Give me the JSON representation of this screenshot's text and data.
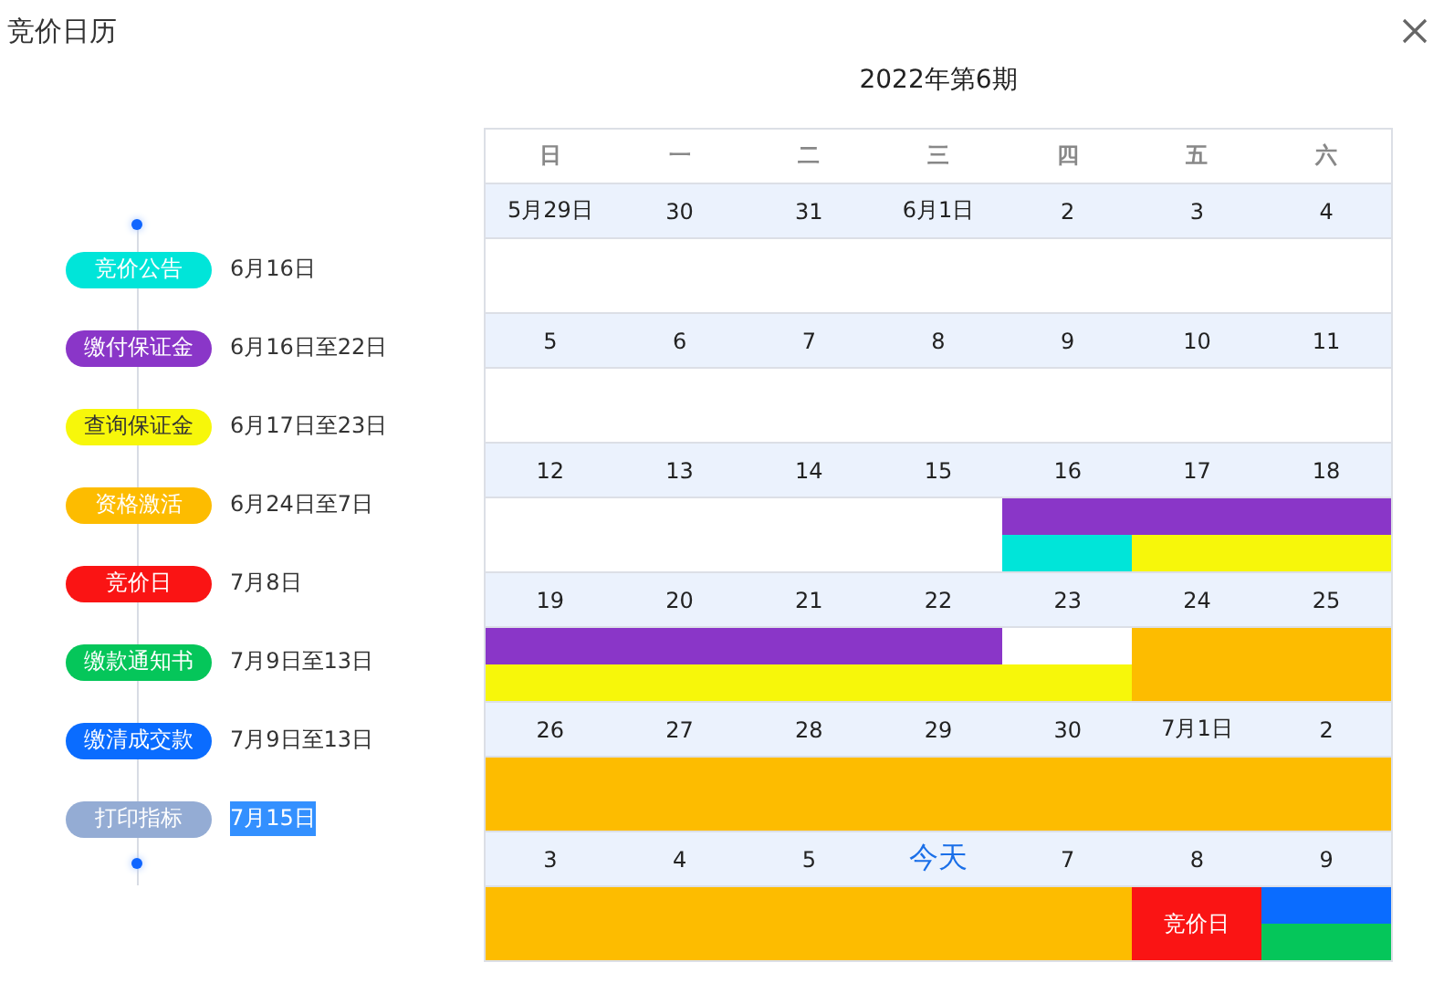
{
  "window": {
    "title": "竞价日历"
  },
  "legend": [
    {
      "label": "竞价公告",
      "dates": "6月16日",
      "color": "#00e5d9",
      "highlighted": false
    },
    {
      "label": "缴付保证金",
      "dates": "6月16日至22日",
      "color": "#8a36c8",
      "highlighted": false
    },
    {
      "label": "查询保证金",
      "dates": "6月17日至23日",
      "color": "#f7f70a",
      "highlighted": false
    },
    {
      "label": "资格激活",
      "dates": "6月24日至7日",
      "color": "#fdbc00",
      "highlighted": false
    },
    {
      "label": "竞价日",
      "dates": "7月8日",
      "color": "#fa1414",
      "highlighted": false
    },
    {
      "label": "缴款通知书",
      "dates": "7月9日至13日",
      "color": "#05c65a",
      "highlighted": false
    },
    {
      "label": "缴清成交款",
      "dates": "7月9日至13日",
      "color": "#0a6cff",
      "highlighted": false
    },
    {
      "label": "打印指标",
      "dates": "7月15日",
      "color": "#94acd4",
      "highlighted": true
    }
  ],
  "calendar": {
    "title": "2022年第6期",
    "weekdays": [
      "日",
      "一",
      "二",
      "三",
      "四",
      "五",
      "六"
    ],
    "weeks": [
      {
        "days": [
          {
            "label": "5月29日",
            "kind": "date"
          },
          {
            "label": "30",
            "kind": "date"
          },
          {
            "label": "31",
            "kind": "date"
          },
          {
            "label": "6月1日",
            "kind": "date"
          },
          {
            "label": "2",
            "kind": "date"
          },
          {
            "label": "3",
            "kind": "date"
          },
          {
            "label": "4",
            "kind": "date"
          }
        ]
      },
      {
        "days": [
          {
            "label": "5",
            "kind": "date"
          },
          {
            "label": "6",
            "kind": "date"
          },
          {
            "label": "7",
            "kind": "date"
          },
          {
            "label": "8",
            "kind": "date"
          },
          {
            "label": "9",
            "kind": "date"
          },
          {
            "label": "10",
            "kind": "date"
          },
          {
            "label": "11",
            "kind": "date"
          }
        ]
      },
      {
        "days": [
          {
            "label": "12",
            "kind": "date"
          },
          {
            "label": "13",
            "kind": "date"
          },
          {
            "label": "14",
            "kind": "date"
          },
          {
            "label": "15",
            "kind": "date"
          },
          {
            "label": "16",
            "kind": "date",
            "top": {
              "color": "#8a36c8"
            },
            "bottom": {
              "color": "#00e5d9"
            }
          },
          {
            "label": "17",
            "kind": "date",
            "top": {
              "color": "#8a36c8"
            },
            "bottom": {
              "color": "#f7f70a"
            }
          },
          {
            "label": "18",
            "kind": "date",
            "top": {
              "color": "#8a36c8"
            },
            "bottom": {
              "color": "#f7f70a"
            }
          }
        ]
      },
      {
        "days": [
          {
            "label": "19",
            "kind": "date",
            "top": {
              "color": "#8a36c8"
            },
            "bottom": {
              "color": "#f7f70a"
            }
          },
          {
            "label": "20",
            "kind": "date",
            "top": {
              "color": "#8a36c8"
            },
            "bottom": {
              "color": "#f7f70a"
            }
          },
          {
            "label": "21",
            "kind": "date",
            "top": {
              "color": "#8a36c8"
            },
            "bottom": {
              "color": "#f7f70a"
            }
          },
          {
            "label": "22",
            "kind": "date",
            "top": {
              "color": "#8a36c8"
            },
            "bottom": {
              "color": "#f7f70a"
            }
          },
          {
            "label": "23",
            "kind": "date",
            "bottom": {
              "color": "#f7f70a"
            }
          },
          {
            "label": "24",
            "kind": "date",
            "full": {
              "color": "#fdbc00"
            }
          },
          {
            "label": "25",
            "kind": "date",
            "full": {
              "color": "#fdbc00"
            }
          }
        ]
      },
      {
        "days": [
          {
            "label": "26",
            "kind": "date",
            "full": {
              "color": "#fdbc00"
            }
          },
          {
            "label": "27",
            "kind": "date",
            "full": {
              "color": "#fdbc00"
            }
          },
          {
            "label": "28",
            "kind": "date",
            "full": {
              "color": "#fdbc00"
            }
          },
          {
            "label": "29",
            "kind": "date",
            "full": {
              "color": "#fdbc00"
            }
          },
          {
            "label": "30",
            "kind": "date",
            "full": {
              "color": "#fdbc00"
            }
          },
          {
            "label": "7月1日",
            "kind": "date",
            "full": {
              "color": "#fdbc00"
            }
          },
          {
            "label": "2",
            "kind": "date",
            "full": {
              "color": "#fdbc00"
            }
          }
        ]
      },
      {
        "days": [
          {
            "label": "3",
            "kind": "date",
            "full": {
              "color": "#fdbc00"
            }
          },
          {
            "label": "4",
            "kind": "date",
            "full": {
              "color": "#fdbc00"
            }
          },
          {
            "label": "5",
            "kind": "date",
            "full": {
              "color": "#fdbc00"
            }
          },
          {
            "label": "今天",
            "kind": "today",
            "full": {
              "color": "#fdbc00"
            }
          },
          {
            "label": "7",
            "kind": "date",
            "full": {
              "color": "#fdbc00"
            }
          },
          {
            "label": "8",
            "kind": "date",
            "full": {
              "color": "#fa1414",
              "label": "竞价日"
            }
          },
          {
            "label": "9",
            "kind": "date",
            "top": {
              "color": "#0a6cff"
            },
            "bottom": {
              "color": "#05c65a"
            }
          }
        ]
      }
    ]
  }
}
